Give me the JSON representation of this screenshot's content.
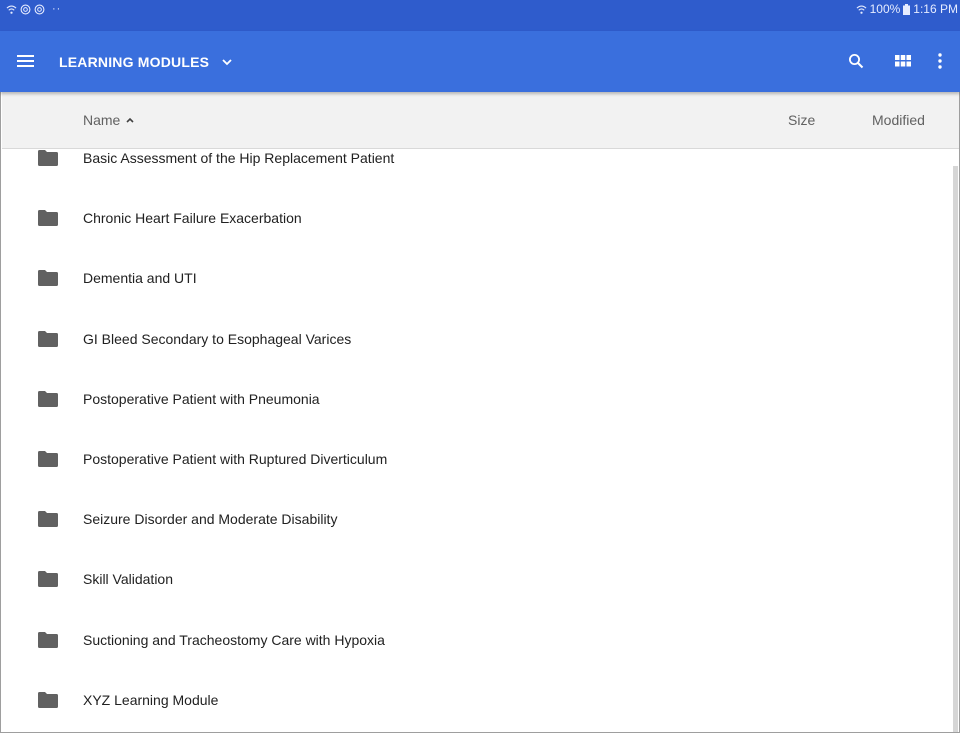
{
  "status_bar": {
    "left_icons": [
      "wifi-icon",
      "sync-icon",
      "sync-icon"
    ],
    "right_text": "100%",
    "time": "1:16 PM"
  },
  "app_bar": {
    "title": "LEARNING MODULES",
    "icons": [
      "menu-icon",
      "chevron-down-icon",
      "search-icon",
      "grid-view-icon",
      "more-vert-icon"
    ],
    "accent_color": "#3a6fdd",
    "status_color": "#2f5ccc"
  },
  "columns": {
    "name": "Name",
    "size": "Size",
    "modified": "Modified"
  },
  "folders": [
    {
      "name": "Basic Assessment of the Hip Replacement Patient"
    },
    {
      "name": "Chronic Heart Failure Exacerbation"
    },
    {
      "name": "Dementia and UTI"
    },
    {
      "name": "GI Bleed Secondary to Esophageal Varices"
    },
    {
      "name": "Postoperative Patient with Pneumonia"
    },
    {
      "name": "Postoperative Patient with Ruptured Diverticulum"
    },
    {
      "name": "Seizure Disorder and Moderate Disability"
    },
    {
      "name": "Skill Validation"
    },
    {
      "name": "Suctioning and Tracheostomy Care with Hypoxia"
    },
    {
      "name": "XYZ Learning Module"
    }
  ]
}
